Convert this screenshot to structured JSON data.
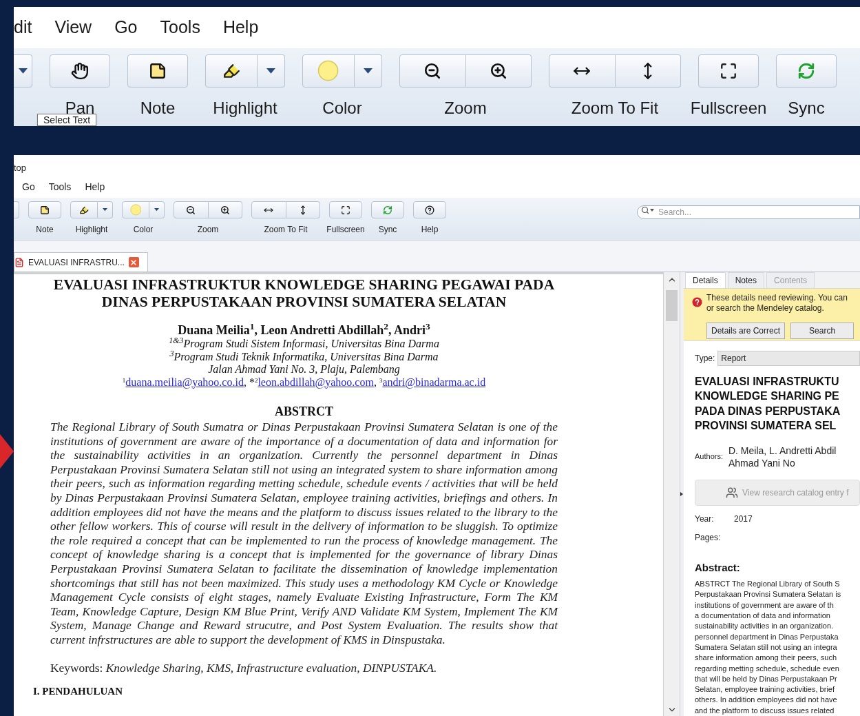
{
  "zoom_view": {
    "menu": [
      "dit",
      "View",
      "Go",
      "Tools",
      "Help"
    ],
    "toolbar": [
      {
        "kind": "caret"
      },
      {
        "kind": "pan",
        "label": "Pan"
      },
      {
        "kind": "note",
        "label": "Note"
      },
      {
        "kind": "highlight",
        "label": "Highlight"
      },
      {
        "kind": "color",
        "label": "Color"
      },
      {
        "kind": "zoom",
        "label": "Zoom"
      },
      {
        "kind": "fit",
        "label": "Zoom To Fit"
      },
      {
        "kind": "fullscreen",
        "label": "Fullscreen"
      },
      {
        "kind": "sync",
        "label": "Sync"
      }
    ],
    "tooltip": "Select Text"
  },
  "window": {
    "title": "top",
    "menu": [
      "Go",
      "Tools",
      "Help"
    ],
    "toolbar": [
      {
        "kind": "edge"
      },
      {
        "kind": "note",
        "label": "Note"
      },
      {
        "kind": "highlight",
        "label": "Highlight"
      },
      {
        "kind": "color",
        "label": "Color"
      },
      {
        "kind": "zoom",
        "label": "Zoom"
      },
      {
        "kind": "fit",
        "label": "Zoom To Fit"
      },
      {
        "kind": "fullscreen",
        "label": "Fullscreen"
      },
      {
        "kind": "sync",
        "label": "Sync"
      },
      {
        "kind": "help",
        "label": "Help"
      }
    ],
    "search": {
      "placeholder": "Search..."
    }
  },
  "tabs": [
    {
      "label": "EVALUASI INFRASTRU...",
      "selected": true
    }
  ],
  "document": {
    "title": [
      "EVALUASI INFRASTRUKTUR KNOWLEDGE SHARING PEGAWAI PADA",
      "DINAS PERPUSTAKAAN PROVINSI SUMATERA SELATAN"
    ],
    "authors": "Duana Meilia$^{1}$, Leon Andretti Abdillah$^{2}$, Andri$^{3}$",
    "affiliations": [
      "$^{1&3}$Program Studi Sistem Informasi, Universitas Bina Darma",
      "$^{3}$Program Studi Teknik Informatika, Universitas Bina Darma",
      "Jalan Ahmad Yani No. 3, Plaju, Palembang"
    ],
    "emails": [
      {
        "mark": "1",
        "address": "duana.meilia@yahoo.co.id"
      },
      {
        "separator": ", *",
        "mark": "2",
        "address": "leon.abdillah@yahoo.com"
      },
      {
        "separator": ", ",
        "mark": "3",
        "address": "andri@binadarma.ac.id"
      }
    ],
    "abstract_heading": "ABSTRCT",
    "abstract": "The Regional Library of South Sumatra or Dinas Perpustakaan Provinsi Sumatera Selatan is one of the institutions of government are aware of the importance of a documentation of data and information for the sustainability activities in an organization. Currently the personnel department in Dinas Perpustakaan Provinsi Sumatera Selatan still not using an integrated system to share information among their peers, such as information regarding metting schedule, schedule events / activities that will be held by Dinas Perpustakaan Provinsi Sumatera Selatan, employee training activities, briefings and others. In addition employees did not have the means and the platform to discuss issues related to the library to the other fellow workers. This of course will result in the delivery of information to be sluggish. To optimize the role required a concept that can be implemented to run the process of knowledge management. The concept of knowledge sharing is a concept that is implemented for the governance of library Dinas Perpustakaan Provinsi Sumatera Selatan to facilitate the dissemination of knowledge implementation shortcomings that still has not been maximized. This study uses a methodology KM Cycle or Knowledge Management Cycle consists of eight stages, namely Evaluate Existing Infrastructure, Form The KM Team, Knowledge Capture, Design KM Blue Print, Verify AND Validate KM System, Implement The KM System, Manage Change and Reward strucutre, and Post System Evaluation. The results show that current infrstructures are able to support the development of KMS in Dinspustaka.",
    "keywords": "Keywords: *Knowledge Sharing, KMS, Infrastructure evaluation, DINPUSTAKA.*",
    "section_heading": "I. PENDAHULUAN"
  },
  "details_panel": {
    "tabs": [
      {
        "label": "Details",
        "selected": true,
        "disabled": false
      },
      {
        "label": "Notes",
        "selected": false,
        "disabled": false
      },
      {
        "label": "Contents",
        "selected": false,
        "disabled": true
      }
    ],
    "notice": [
      "These details need reviewing. You can",
      "or search the Mendeley catalog."
    ],
    "notice_buttons": [
      "Details are Correct",
      "Search"
    ],
    "type_label": "Type:",
    "type_value": "Report",
    "title": [
      "EVALUASI INFRASTRUKTU",
      "KNOWLEDGE SHARING PE",
      "PADA DINAS PERPUSTAKA",
      "PROVINSI SUMATERA SEL"
    ],
    "authors_label": "Authors:",
    "authors": [
      "D. Meila, L. Andretti Abdil",
      "Ahmad Yani No"
    ],
    "catalog_link": "View research catalog entry f",
    "year_label": "Year:",
    "year": "2017",
    "pages_label": "Pages:",
    "abstract_heading": "Abstract:",
    "abstract": [
      "ABSTRCT The Regional Library of South S",
      "Perpustakaan Provinsi Sumatera Selatan is",
      "institutions of government are aware of th",
      "a documentation of data and information",
      "sustainability activities in an organization.",
      "personnel department in Dinas Perpustaka",
      "Sumatera Selatan still not using an integra",
      "share information among their peers, such",
      "regarding metting schedule, schedule even",
      "that will be held by Dinas Perpustakaan Pr",
      "Selatan, employee training activities, brief",
      "others. In addition employees did not have",
      "and the platform to discuss issues related"
    ]
  }
}
